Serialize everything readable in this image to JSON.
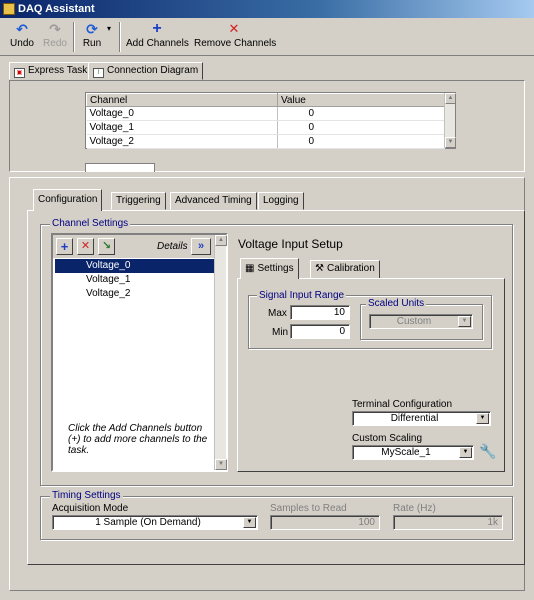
{
  "window": {
    "title": "DAQ Assistant"
  },
  "toolbar": {
    "undo": "Undo",
    "redo": "Redo",
    "run": "Run",
    "add_channels": "Add Channels",
    "remove_channels": "Remove Channels"
  },
  "view_tabs": {
    "express_task": "Express Task",
    "connection_diagram": "Connection Diagram"
  },
  "value_table": {
    "headers": {
      "channel": "Channel",
      "value": "Value"
    },
    "rows": [
      {
        "channel": "Voltage_0",
        "value": "0"
      },
      {
        "channel": "Voltage_1",
        "value": "0"
      },
      {
        "channel": "Voltage_2",
        "value": "0"
      }
    ]
  },
  "config_tabs": {
    "configuration": "Configuration",
    "triggering": "Triggering",
    "advanced_timing": "Advanced Timing",
    "logging": "Logging"
  },
  "channel_settings": {
    "group_label": "Channel Settings",
    "details_label": "Details",
    "channels": [
      "Voltage_0",
      "Voltage_1",
      "Voltage_2"
    ],
    "hint": "Click the Add Channels button (+) to add more channels to the task."
  },
  "voltage_setup": {
    "title": "Voltage Input Setup",
    "tab_settings": "Settings",
    "tab_calibration": "Calibration",
    "signal_range_label": "Signal Input Range",
    "max_label": "Max",
    "max_value": "10",
    "min_label": "Min",
    "min_value": "0",
    "scaled_units_label": "Scaled Units",
    "scaled_units_value": "Custom",
    "terminal_config_label": "Terminal Configuration",
    "terminal_config_value": "Differential",
    "custom_scaling_label": "Custom Scaling",
    "custom_scaling_value": "MyScale_1"
  },
  "timing": {
    "group_label": "Timing Settings",
    "acq_mode_label": "Acquisition Mode",
    "acq_mode_value": "1 Sample (On Demand)",
    "samples_label": "Samples to Read",
    "samples_value": "100",
    "rate_label": "Rate (Hz)",
    "rate_value": "1k"
  },
  "colors": {
    "selection": "#0a246a",
    "group_label": "#000080",
    "face": "#d4d0c8"
  }
}
